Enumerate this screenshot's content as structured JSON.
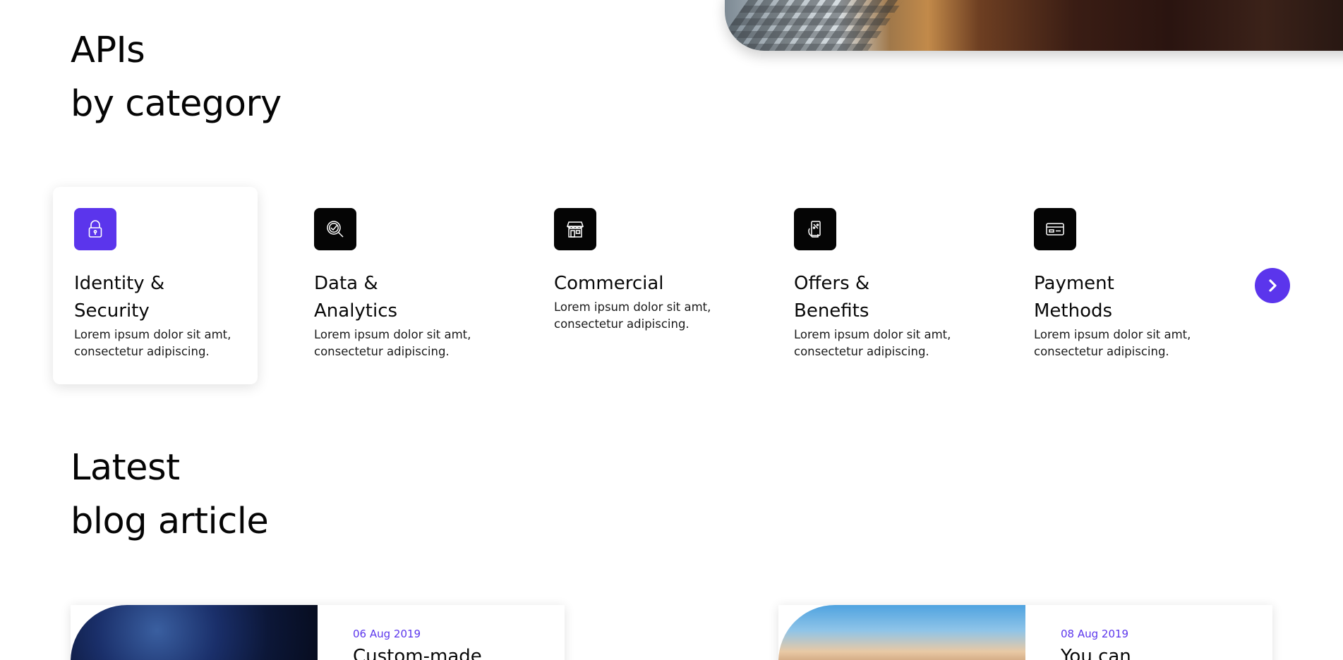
{
  "colors": {
    "accent": "#5b35ec",
    "icon_bg": "#050505",
    "text": "#0a0a0a"
  },
  "apis_section": {
    "title_line1": "APIs",
    "title_line2": "by category",
    "categories": [
      {
        "name_line1": "Identity &",
        "name_line2": "Security",
        "description": "Lorem ipsum dolor sit amt, consectetur adipiscing.",
        "icon": "lock-icon",
        "active": true
      },
      {
        "name_line1": "Data &",
        "name_line2": "Analytics",
        "description": "Lorem ipsum dolor sit amt, consectetur adipiscing.",
        "icon": "analytics-magnifier-icon",
        "active": false
      },
      {
        "name_line1": "Commercial",
        "name_line2": "",
        "description": "Lorem ipsum dolor sit amt, consectetur adipiscing.",
        "icon": "storefront-icon",
        "active": false
      },
      {
        "name_line1": "Offers &",
        "name_line2": "Benefits",
        "description": "Lorem ipsum dolor sit amt, consectetur adipiscing.",
        "icon": "mobile-offer-icon",
        "active": false
      },
      {
        "name_line1": "Payment",
        "name_line2": "Methods",
        "description": "Lorem ipsum dolor sit amt, consectetur adipiscing.",
        "icon": "credit-card-icon",
        "active": false
      }
    ],
    "next_icon": "chevron-right-icon"
  },
  "blog_section": {
    "title_line1": "Latest",
    "title_line2": "blog article",
    "articles": [
      {
        "date": "06 Aug 2019",
        "headline": "Custom-made"
      },
      {
        "date": "08 Aug 2019",
        "headline": "You can"
      }
    ]
  }
}
